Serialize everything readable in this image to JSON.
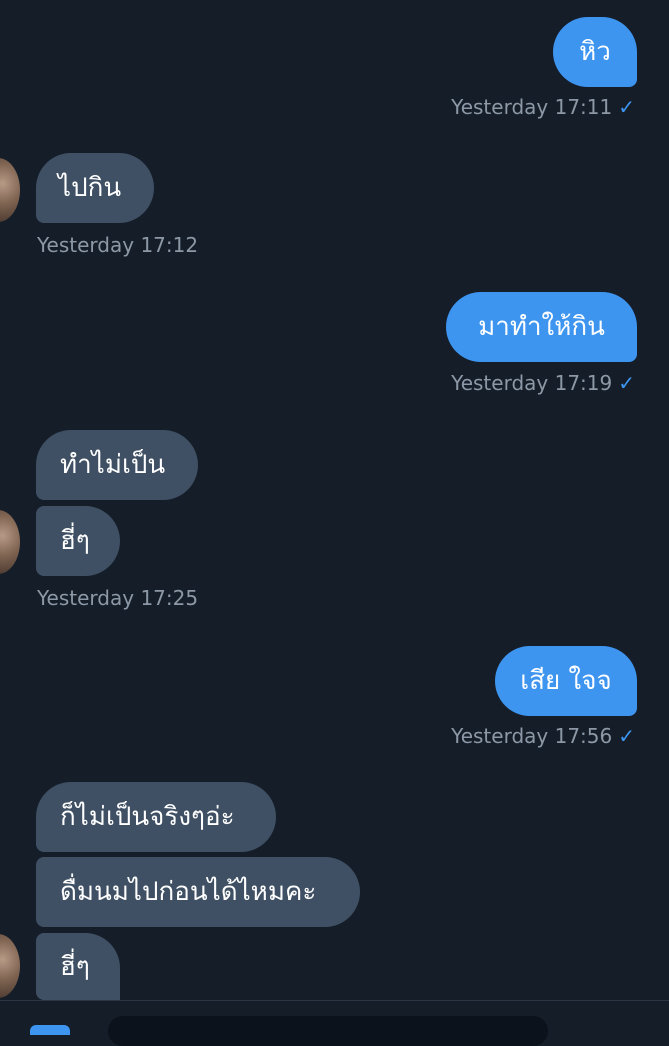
{
  "messages": [
    {
      "text": "หิว",
      "timestamp": "Yesterday 17:11",
      "read_mark": "✓"
    },
    {
      "text": "ไปกิน",
      "timestamp": "Yesterday 17:12"
    },
    {
      "text": "มาทำให้กิน",
      "timestamp": "Yesterday 17:19",
      "read_mark": "✓"
    },
    {
      "text": "ทำไม่เป็น"
    },
    {
      "text": "ฮี่ๆ",
      "timestamp": "Yesterday 17:25"
    },
    {
      "text": "เสีย ใจจ",
      "timestamp": "Yesterday 17:56",
      "read_mark": "✓"
    },
    {
      "text": "ก็ไม่เป็นจริงๆอ่ะ"
    },
    {
      "text": "ดื่มนมไปก่อนได้ไหมคะ"
    },
    {
      "text": "ฮี่ๆ"
    }
  ],
  "colors": {
    "background": "#151d29",
    "outgoing_bubble": "#3d95f0",
    "incoming_bubble": "#3f5064",
    "timestamp_text": "#8c98a6",
    "read_check": "#3d95f0"
  },
  "icons": {
    "read_check": "check-icon",
    "avatar": "contact-avatar"
  }
}
